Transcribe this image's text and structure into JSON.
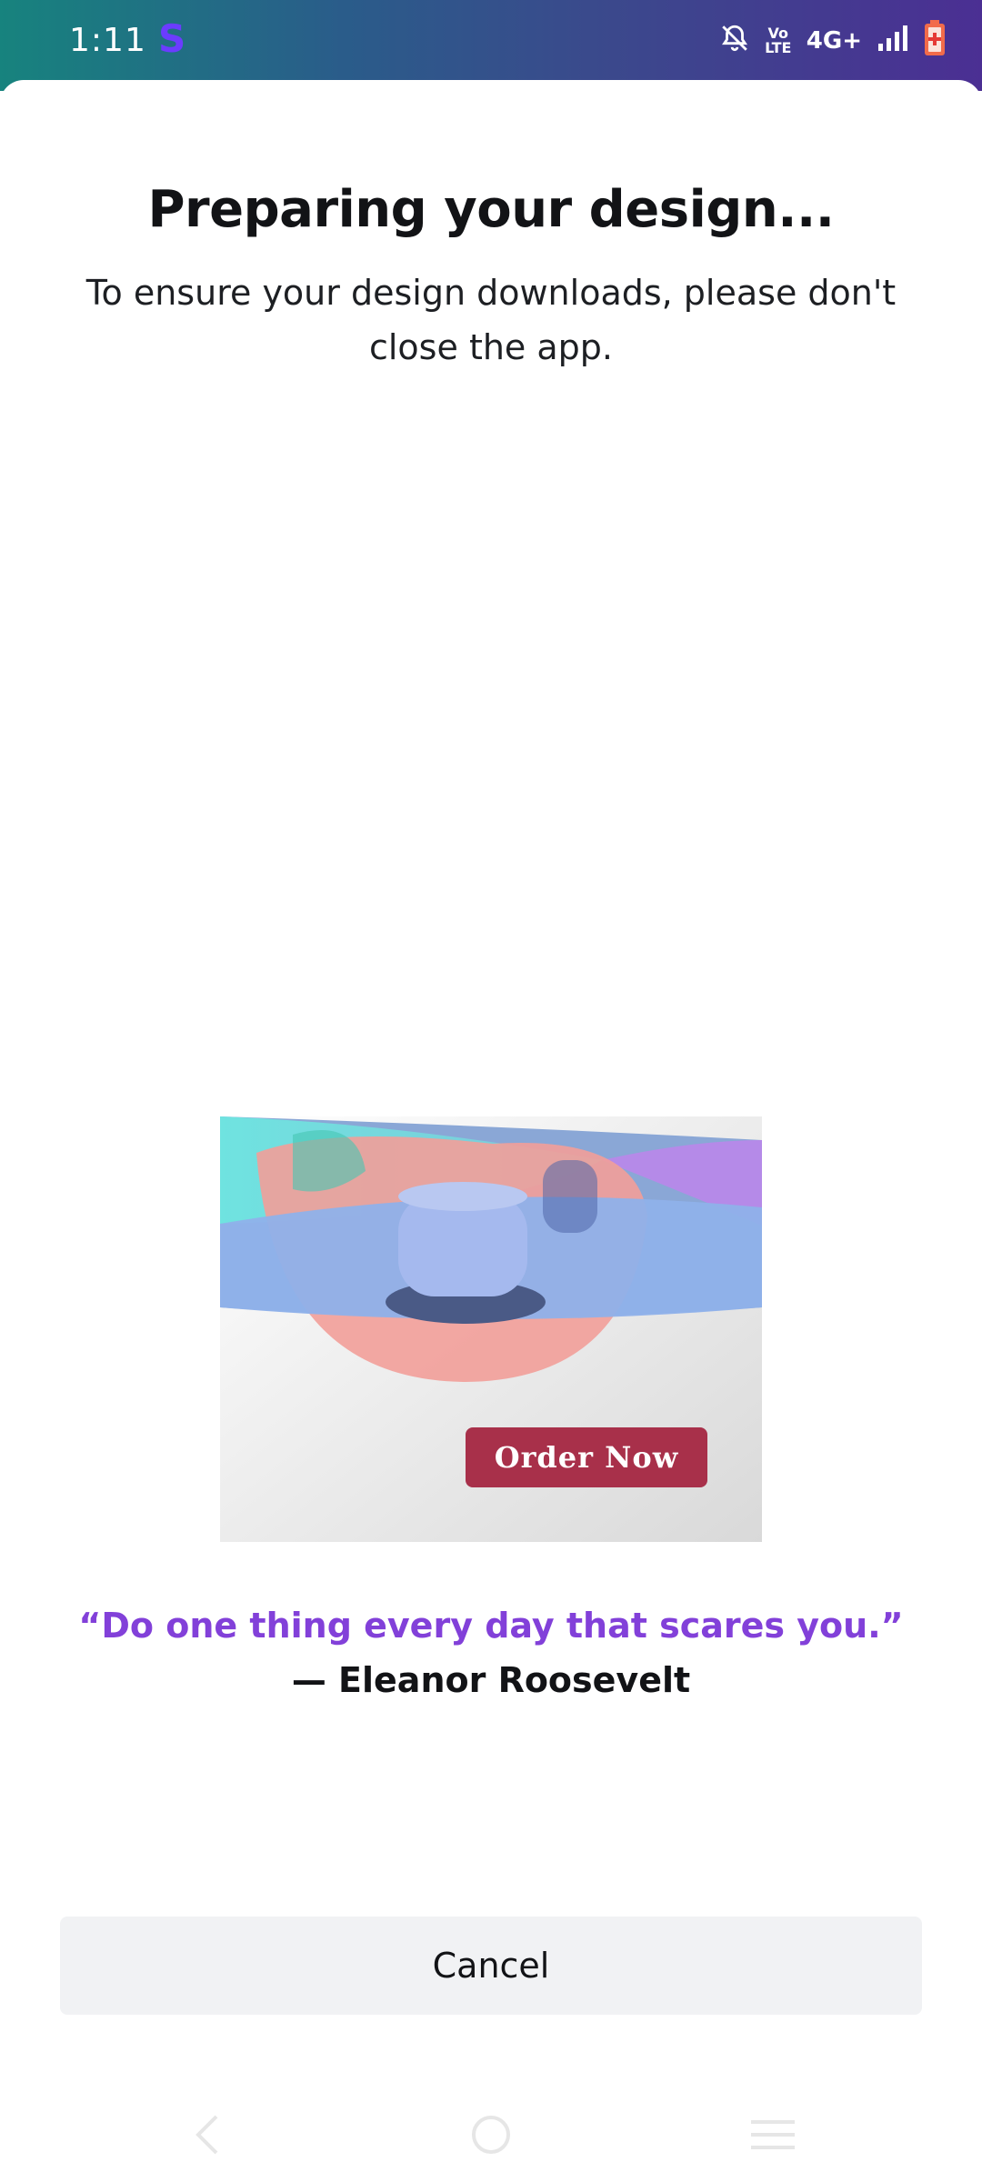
{
  "status_bar": {
    "time": "1:11",
    "app_badge": "S",
    "network": "4G+",
    "volte_label": "Vo LTE"
  },
  "dialog": {
    "title": "Preparing your design...",
    "subtitle": "To ensure your design downloads, please don't close the app."
  },
  "preview": {
    "cta_label": "Order Now"
  },
  "quote": {
    "text": "“Do one thing every day that scares you.”",
    "author": "— Eleanor Roosevelt"
  },
  "actions": {
    "cancel_label": "Cancel"
  },
  "colors": {
    "accent_purple": "#8240d9",
    "cta_red": "#a8304a",
    "status_gradient_start": "#17837e",
    "status_gradient_end": "#4b2f93"
  },
  "icons": [
    "mute-bell-icon",
    "volte-icon",
    "signal-icon",
    "battery-charging-icon",
    "back-icon",
    "home-icon",
    "recents-icon"
  ]
}
